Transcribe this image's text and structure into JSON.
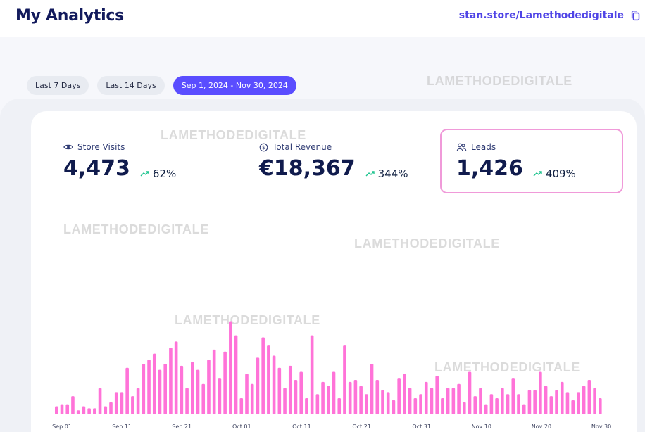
{
  "header": {
    "title": "My Analytics",
    "store_link": "stan.store/Lamethodedigitale",
    "copy_icon": "copy-icon"
  },
  "filters": [
    {
      "label": "Last 7 Days",
      "active": false
    },
    {
      "label": "Last 14 Days",
      "active": false
    },
    {
      "label": "Sep 1, 2024 - Nov 30, 2024",
      "active": true
    }
  ],
  "metrics": {
    "store_visits": {
      "label": "Store Visits",
      "icon": "eye-icon",
      "value": "4,473",
      "change": "62%"
    },
    "total_revenue": {
      "label": "Total Revenue",
      "icon": "dollar-circle-icon",
      "value": "€18,367",
      "change": "344%"
    },
    "leads": {
      "label": "Leads",
      "icon": "users-icon",
      "value": "1,426",
      "change": "409%"
    }
  },
  "watermark_text": "LAMETHODEDIGITALE",
  "colors": {
    "accent": "#5a4dff",
    "bar": "#ff73d8",
    "leads_border": "#f09ad9",
    "trend_up": "#1ec48f"
  },
  "chart_data": {
    "type": "bar",
    "title": "",
    "xlabel": "",
    "ylabel": "",
    "x_tick_labels": [
      "Sep 01",
      "Sep 11",
      "Sep 21",
      "Oct 01",
      "Oct 11",
      "Oct 21",
      "Oct 31",
      "Nov 10",
      "Nov 20",
      "Nov 30"
    ],
    "ylim": [
      0,
      50
    ],
    "values": [
      4,
      5,
      5,
      9,
      2,
      4,
      3,
      3,
      13,
      4,
      6,
      11,
      11,
      23,
      9,
      13,
      25,
      27,
      30,
      22,
      25,
      33,
      36,
      24,
      13,
      26,
      22,
      15,
      27,
      32,
      18,
      31,
      46,
      39,
      8,
      20,
      15,
      28,
      38,
      34,
      29,
      23,
      13,
      24,
      17,
      21,
      8,
      39,
      10,
      16,
      14,
      21,
      8,
      34,
      16,
      17,
      14,
      10,
      25,
      17,
      12,
      11,
      7,
      18,
      20,
      13,
      8,
      10,
      16,
      13,
      19,
      8,
      13,
      13,
      15,
      6,
      21,
      9,
      13,
      5,
      10,
      8,
      13,
      10,
      18,
      10,
      5,
      12,
      12,
      21,
      14,
      9,
      12,
      16,
      11,
      7,
      11,
      14,
      17,
      13,
      8
    ]
  }
}
